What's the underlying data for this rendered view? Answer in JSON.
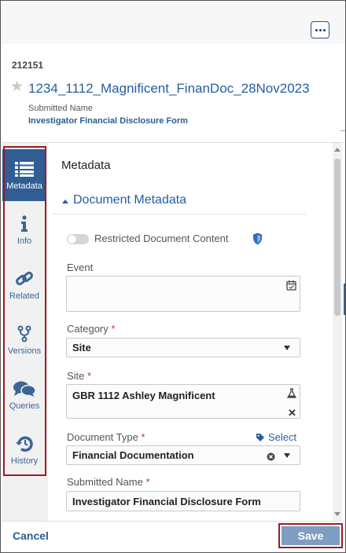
{
  "header": {
    "more_icon": "ellipsis-icon",
    "doc_id": "212151",
    "star_icon": "star-icon",
    "title": "1234_1112_Magnificent_FinanDoc_28Nov2023",
    "submitted_name_label": "Submitted Name",
    "submitted_name_value": "Investigator Financial Disclosure Form"
  },
  "sidebar": {
    "items": [
      {
        "label": "Metadata",
        "icon": "list-icon",
        "active": true
      },
      {
        "label": "Info",
        "icon": "info-icon",
        "active": false
      },
      {
        "label": "Related",
        "icon": "link-icon",
        "active": false
      },
      {
        "label": "Versions",
        "icon": "branch-icon",
        "active": false
      },
      {
        "label": "Queries",
        "icon": "chat-icon",
        "active": false
      },
      {
        "label": "History",
        "icon": "history-icon",
        "active": false
      }
    ]
  },
  "main": {
    "section_title": "Metadata",
    "group_title": "Document Metadata",
    "restricted_label": "Restricted Document Content",
    "restricted_on": false,
    "event_label": "Event",
    "event_value": "",
    "category_label": "Category",
    "category_value": "Site",
    "site_label": "Site",
    "site_value": "GBR 1112 Ashley Magnificent",
    "doc_type_label": "Document Type",
    "doc_type_value": "Financial Documentation",
    "select_link": "Select",
    "submitted_name_label": "Submitted Name",
    "submitted_name_value": "Investigator Financial Disclosure Form",
    "required_mark": "*"
  },
  "footer": {
    "cancel_label": "Cancel",
    "save_label": "Save"
  },
  "colors": {
    "accent": "#235ea0",
    "sidebar_active": "#2f5d94",
    "highlight_outline": "#9b1c24",
    "save_button": "#7f9dc1"
  }
}
